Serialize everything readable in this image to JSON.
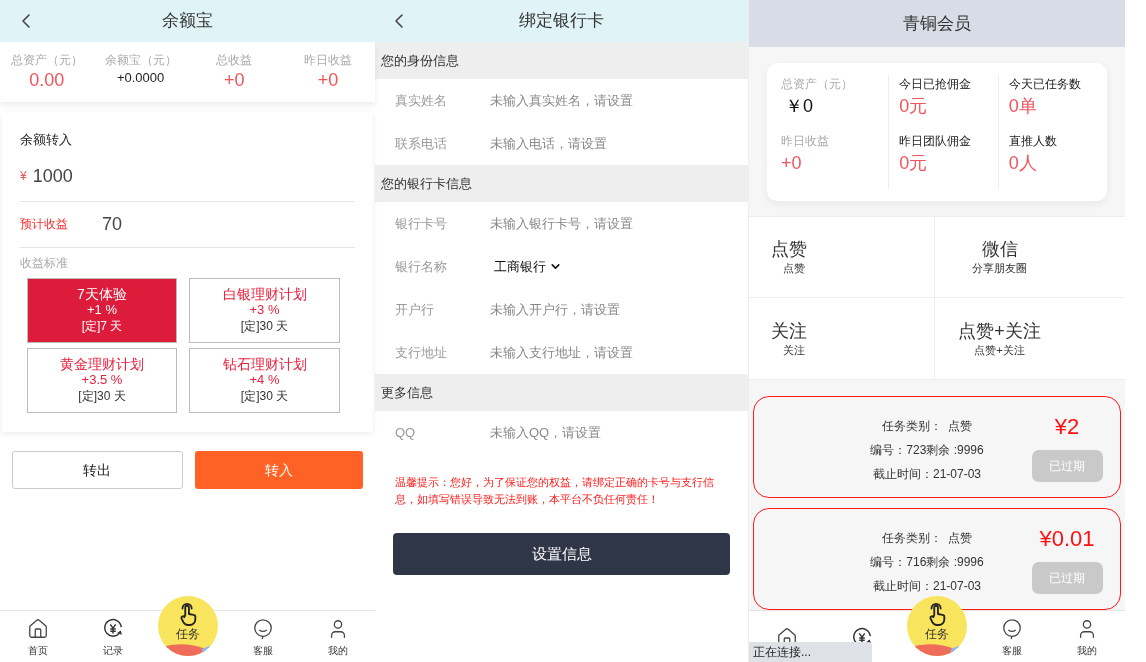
{
  "yuebao": {
    "title": "余额宝",
    "stats": [
      {
        "label": "总资产（元）",
        "value": "0.00",
        "kind": "highlight"
      },
      {
        "label": "余额宝（元）",
        "value": "+0.0000",
        "kind": "plain"
      },
      {
        "label": "总收益",
        "value": "+0",
        "kind": "highlight"
      },
      {
        "label": "昨日收益",
        "value": "+0",
        "kind": "highlight"
      }
    ],
    "transfer": {
      "label": "余额转入",
      "currency": "¥",
      "amount": "1000",
      "estimate_label": "预计收益",
      "estimate_value": "70",
      "standard_label": "收益标准"
    },
    "plans": [
      {
        "name": "7天体验",
        "rate": "+1 %",
        "term": "[定]7 天",
        "selected": true
      },
      {
        "name": "白银理财计划",
        "rate": "+3 %",
        "term": "[定]30 天",
        "selected": false
      },
      {
        "name": "黄金理财计划",
        "rate": "+3.5 %",
        "term": "[定]30 天",
        "selected": false
      },
      {
        "name": "钻石理财计划",
        "rate": "+4 %",
        "term": "[定]30 天",
        "selected": false
      }
    ],
    "buttons": [
      {
        "label": "转出",
        "kind": "outline"
      },
      {
        "label": "转入",
        "kind": "primary"
      }
    ],
    "tabbar": [
      {
        "label": "首页"
      },
      {
        "label": "记录"
      },
      {
        "label": "任务",
        "kind": "center"
      },
      {
        "label": "客服"
      },
      {
        "label": "我的"
      }
    ]
  },
  "bind_card": {
    "title": "绑定银行卡",
    "sections": [
      {
        "heading": "您的身份信息",
        "rows": [
          {
            "kind": "input",
            "label": "真实姓名",
            "placeholder": "未输入真实姓名，请设置"
          },
          {
            "kind": "input",
            "label": "联系电话",
            "placeholder": "未输入电话，请设置"
          }
        ]
      },
      {
        "heading": "您的银行卡信息",
        "rows": [
          {
            "kind": "input",
            "label": "银行卡号",
            "placeholder": "未输入银行卡号，请设置"
          },
          {
            "kind": "select",
            "label": "银行名称",
            "value": "工商银行"
          },
          {
            "kind": "input",
            "label": "开户行",
            "placeholder": "未输入开户行，请设置"
          },
          {
            "kind": "input",
            "label": "支行地址",
            "placeholder": "未输入支行地址，请设置"
          }
        ]
      },
      {
        "heading": "更多信息",
        "rows": [
          {
            "kind": "input",
            "label": "QQ",
            "placeholder": "未输入QQ，请设置"
          }
        ]
      }
    ],
    "notice": "温馨提示：您好，为了保证您的权益，请绑定正确的卡号与支行信息，如填写错误导致无法到账，本平台不负任何责任！",
    "submit": "设置信息"
  },
  "member": {
    "title": "青铜会员",
    "stats": [
      {
        "label": "总资产（元）",
        "value": "￥0",
        "muted": true,
        "kind": "plain"
      },
      {
        "label": "今日已抢佣金",
        "value": "0元",
        "muted": false,
        "kind": "highlight"
      },
      {
        "label": "今天已任务数",
        "value": "0单",
        "muted": false,
        "kind": "highlight"
      },
      {
        "label": "昨日收益",
        "value": "+0",
        "muted": true,
        "kind": "highlight"
      },
      {
        "label": "昨日团队佣金",
        "value": "0元",
        "muted": false,
        "kind": "highlight"
      },
      {
        "label": "直推人数",
        "value": "0人",
        "muted": false,
        "kind": "highlight"
      }
    ],
    "task_types": [
      {
        "title": "点赞",
        "subtitle": "点赞"
      },
      {
        "title": "微信",
        "subtitle": "分享朋友圈"
      },
      {
        "title": "关注",
        "subtitle": "关注"
      },
      {
        "title": "点赞+关注",
        "subtitle": "点赞+关注"
      }
    ],
    "tasks": [
      {
        "lines": [
          "任务类别：  点赞",
          "编号：723剩余 :9996",
          "截止时间：21-07-03"
        ],
        "price": "¥2",
        "status": "已过期",
        "disabled": true
      },
      {
        "lines": [
          "任务类别：  点赞",
          "编号：716剩余 :9996",
          "截止时间：21-07-03"
        ],
        "price": "¥0.01",
        "status": "已过期",
        "disabled": true
      }
    ],
    "tabbar": [
      {
        "kind": "plain"
      },
      {
        "kind": "plain"
      },
      {
        "label": "任务",
        "kind": "center"
      },
      {
        "label": "客服"
      },
      {
        "label": "我的"
      }
    ],
    "status_overlay": "正在连接..."
  }
}
